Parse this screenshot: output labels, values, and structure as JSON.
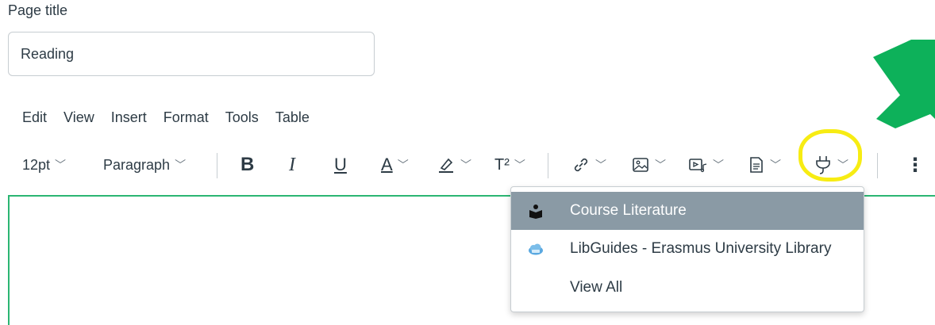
{
  "form": {
    "page_title_label": "Page title",
    "page_title_value": "Reading"
  },
  "menubar": {
    "items": [
      "Edit",
      "View",
      "Insert",
      "Format",
      "Tools",
      "Table"
    ]
  },
  "toolbar": {
    "font_size": "12pt",
    "block_format": "Paragraph",
    "bold_glyph": "B",
    "italic_glyph": "I",
    "underline_glyph": "U",
    "text_color_glyph": "A",
    "superscript_glyph": "T²",
    "more_glyph": "⋮"
  },
  "plugins_dropdown": {
    "items": [
      {
        "label": "Course Literature",
        "icon": "course-literature-icon",
        "active": true
      },
      {
        "label": "LibGuides - Erasmus University Library",
        "icon": "libguides-cloud-icon",
        "active": false
      },
      {
        "label": "View All",
        "icon": "",
        "active": false
      }
    ]
  },
  "colors": {
    "editor_focus_border": "#2bb673",
    "active_menu_bg": "#8a9aa5",
    "highlight_circle": "#f7ec13",
    "annotation_arrow": "#0db15a",
    "text": "#2d3b45"
  }
}
